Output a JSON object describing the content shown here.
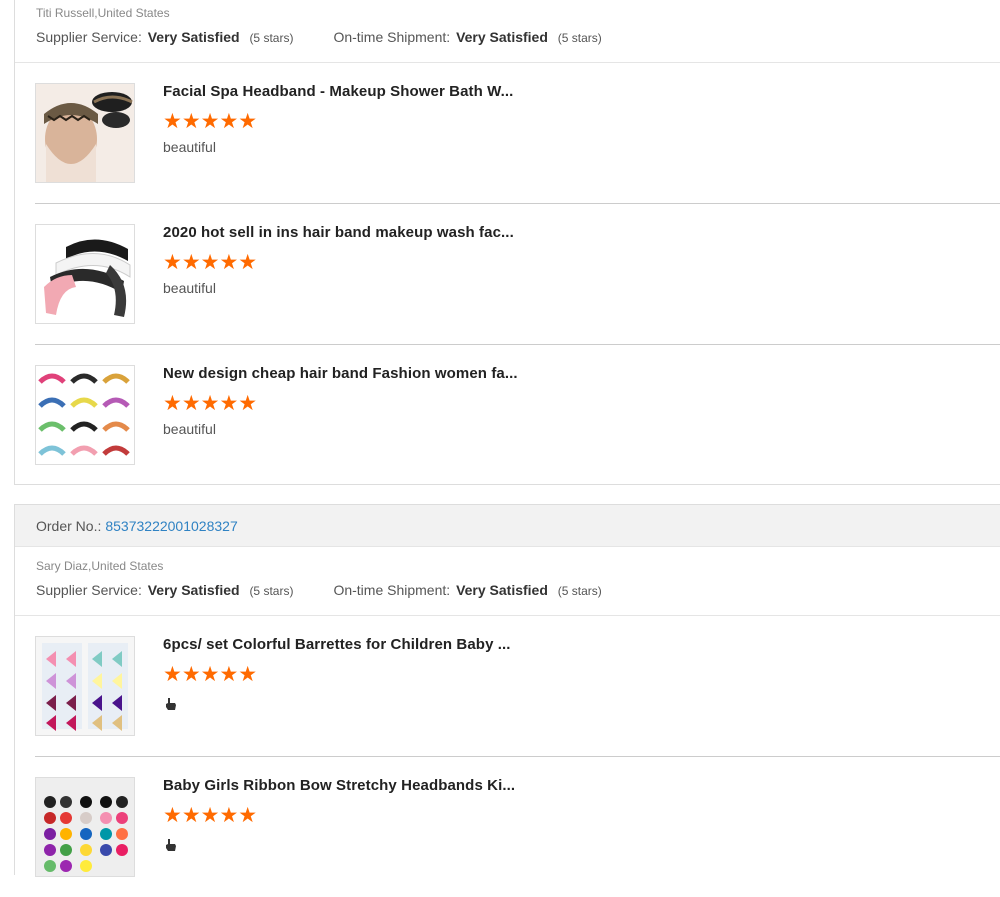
{
  "orders": [
    {
      "buyer": "Titi Russell,United States",
      "supplier_label": "Supplier Service:",
      "supplier_value": "Very Satisfied",
      "supplier_stars": "(5 stars)",
      "shipment_label": "On-time Shipment:",
      "shipment_value": "Very Satisfied",
      "shipment_stars": "(5 stars)",
      "items": [
        {
          "title": "Facial Spa Headband - Makeup Shower Bath W...",
          "rating": 5,
          "comment": "beautiful"
        },
        {
          "title": "2020 hot sell in ins hair band makeup wash fac...",
          "rating": 5,
          "comment": "beautiful"
        },
        {
          "title": "New design cheap hair band Fashion women fa...",
          "rating": 5,
          "comment": "beautiful"
        }
      ]
    },
    {
      "order_label": "Order No.:",
      "order_number": "85373222001028327",
      "buyer": "Sary Diaz,United States",
      "supplier_label": "Supplier Service:",
      "supplier_value": "Very Satisfied",
      "supplier_stars": "(5 stars)",
      "shipment_label": "On-time Shipment:",
      "shipment_value": "Very Satisfied",
      "shipment_stars": "(5 stars)",
      "items": [
        {
          "title": "6pcs/ set Colorful Barrettes for Children Baby ...",
          "rating": 5,
          "comment_icon": "thumbs-up-icon"
        },
        {
          "title": "Baby Girls Ribbon Bow Stretchy Headbands Ki...",
          "rating": 5,
          "comment_icon": "thumbs-up-icon"
        }
      ]
    }
  ],
  "stars_glyph": "★★★★★",
  "colors": {
    "star": "#ff6a00",
    "link": "#2f82c3",
    "header_bg": "#f2f2f2"
  }
}
